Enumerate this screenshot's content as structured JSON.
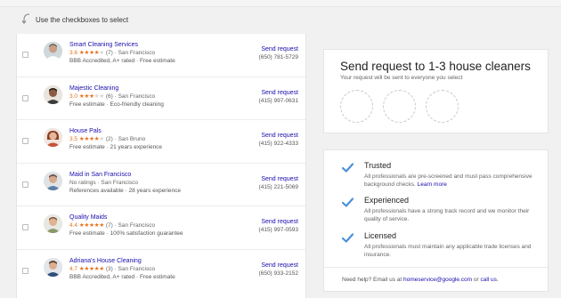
{
  "hint": {
    "text": "Use the checkboxes to select"
  },
  "providers": [
    {
      "name": "Smart Cleaning Services",
      "rating": "3.6",
      "stars": "★★★★",
      "stars_off": "★",
      "reviews": "(7)",
      "location": "· San Francisco",
      "details": "BBB Accredited, A+ rated · Free estimate",
      "send_label": "Send request",
      "phone": "(650) 781-5729"
    },
    {
      "name": "Majestic Cleaning",
      "rating": "3.0",
      "stars": "★★★",
      "stars_off": "★★",
      "reviews": "(6)",
      "location": "· San Francisco",
      "details": "Free estimate · Eco-friendly cleaning",
      "send_label": "Send request",
      "phone": "(415) 997-0631"
    },
    {
      "name": "House Pals",
      "rating": "3.5",
      "stars": "★★★★",
      "stars_off": "★",
      "reviews": "(2)",
      "location": "· San Bruno",
      "details": "Free estimate · 21 years experience",
      "send_label": "Send request",
      "phone": "(415) 922-4333"
    },
    {
      "name": "Maid in San Francisco",
      "rating": "",
      "stars": "",
      "stars_off": "",
      "reviews": "No ratings",
      "location": "· San Francisco",
      "details": "References available · 28 years experience",
      "send_label": "Send request",
      "phone": "(415) 221-5069"
    },
    {
      "name": "Quality Maids",
      "rating": "4.4",
      "stars": "★★★★★",
      "stars_off": "",
      "reviews": "(7)",
      "location": "· San Francisco",
      "details": "Free estimate · 100% satisfaction guarantee",
      "send_label": "Send request",
      "phone": "(415) 997-0593"
    },
    {
      "name": "Adriana's House Cleaning",
      "rating": "4.7",
      "stars": "★★★★★",
      "stars_off": "",
      "reviews": "(3)",
      "location": "· San Francisco",
      "details": "BBB Accredited, A+ rated · Free estimate",
      "send_label": "Send request",
      "phone": "(650) 933-2152"
    }
  ],
  "request_card": {
    "title": "Send request to 1-3 house cleaners",
    "subtitle": "Your request will be sent to everyone you select"
  },
  "features": [
    {
      "title": "Trusted",
      "desc": "All professionals are pre-screened and must pass comprehensive background checks.",
      "link": "Learn more"
    },
    {
      "title": "Experienced",
      "desc": "All professionals have a strong track record and we monitor their quality of service.",
      "link": ""
    },
    {
      "title": "Licensed",
      "desc": "All professionals must maintain any applicable trade licenses and insurance.",
      "link": ""
    }
  ],
  "help": {
    "prefix": "Need help? Email us at",
    "email": "homeservice@google.com",
    "middle": "or",
    "call": "call us",
    "suffix": "."
  },
  "colors": {
    "link": "#1a0dab",
    "star": "#e7711b",
    "check": "#4a90d9"
  },
  "icons": {
    "hint": "curved-arrow-icon",
    "feature": "checkmark-icon"
  }
}
